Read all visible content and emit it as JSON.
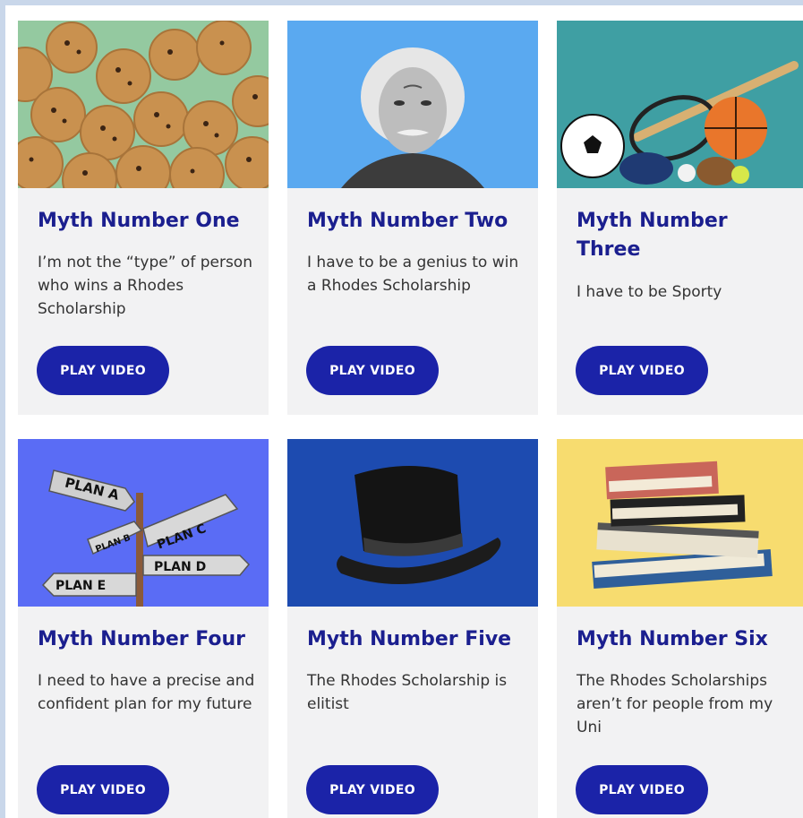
{
  "cards": [
    {
      "title": "Myth Number One",
      "desc": "I’m not the “type” of person who wins a Rhodes Scholarship",
      "button": "PLAY VIDEO",
      "image_bg": "#94c9a0",
      "image": "cookies-image"
    },
    {
      "title": "Myth Number Two",
      "desc": "I have to be a genius to win a Rhodes Scholarship",
      "button": "PLAY VIDEO",
      "image_bg": "#5aa9f0",
      "image": "einstein-portrait-image"
    },
    {
      "title": "Myth Number Three",
      "desc": "I have to be Sporty",
      "button": "PLAY VIDEO",
      "image_bg": "#3f9fa3",
      "image": "sports-equipment-image"
    },
    {
      "title": "Myth Number Four",
      "desc": "I need to have a precise and confident plan for my future",
      "button": "PLAY VIDEO",
      "image_bg": "#5a6cf5",
      "image": "signpost-image",
      "signs": [
        "PLAN A",
        "PLAN B",
        "PLAN C",
        "PLAN D",
        "PLAN E"
      ]
    },
    {
      "title": "Myth Number Five",
      "desc": "The Rhodes Scholarship is elitist",
      "button": "PLAY VIDEO",
      "image_bg": "#1d4bb0",
      "image": "top-hat-image"
    },
    {
      "title": "Myth Number Six",
      "desc": "The Rhodes Scholarships aren’t for people from my Uni",
      "button": "PLAY VIDEO",
      "image_bg": "#f7dc6f",
      "image": "books-image"
    }
  ]
}
